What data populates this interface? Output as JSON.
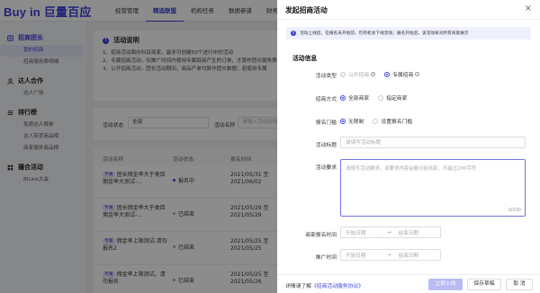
{
  "app": {
    "logo": "Buy in 巨量百应",
    "nav": [
      "经营管理",
      "精选联盟",
      "机构任务",
      "数据参谋",
      "财务结算"
    ],
    "nav_active": 1
  },
  "sidebar": {
    "groups": [
      {
        "label": "招商团长",
        "icon": "team-icon",
        "active": true,
        "items": [
          {
            "label": "我的招商",
            "active": true
          },
          {
            "label": "招商服务费明细",
            "active": false
          }
        ]
      },
      {
        "label": "达人合作",
        "icon": "cooperation-icon",
        "active": false,
        "items": [
          {
            "label": "达人广场",
            "active": false
          }
        ]
      },
      {
        "label": "排行榜",
        "icon": "ranking-icon",
        "active": false,
        "items": [
          {
            "label": "免费达人榜单",
            "active": false
          },
          {
            "label": "达人带货商品榜",
            "active": false
          },
          {
            "label": "商家服务商品榜",
            "active": false
          }
        ]
      },
      {
        "label": "撮合活动",
        "icon": "match-icon",
        "active": false,
        "items": [
          {
            "label": "BiLink大会",
            "active": false
          }
        ]
      }
    ]
  },
  "activity_desc": {
    "title": "活动说明",
    "lines": [
      "1、招商活动面向科目商家，最多可创建50个进行中的活动",
      "2、专属招商活动，仅推广时间内使用专属链接产生的订单，才算作团长服务费",
      "3、公开招商活动，团长活动期间，商品产单均算作团长数据；若使用专属"
    ]
  },
  "filters": {
    "status_label": "活动状态",
    "status_value": "全部",
    "name_label": "活动名称",
    "name_placeholder": "请输入活动名称"
  },
  "table": {
    "headers": [
      "活动名称",
      "活动状态",
      "报名时间"
    ],
    "rows": [
      {
        "tag": "专属",
        "name": "团长佣金率大于类目佣金率大测试-...",
        "status": "报名中",
        "status_done": false,
        "time": "2021/05/31 至 2021/06/02"
      },
      {
        "tag": "专属",
        "name": "团长佣金率大于类目佣金率大测试-...",
        "status": "已结束",
        "status_done": true,
        "time": "2021/05/29 至 2021/05/29"
      },
      {
        "tag": "专属",
        "name": "佣金率上限测试-请勿报名2",
        "status": "已结束",
        "status_done": true,
        "time": "2021/05/25 至 2021/05/25"
      },
      {
        "tag": "专属",
        "name": "佣金率上限测试，请勿报名",
        "status": "已结束",
        "status_done": true,
        "time": "2021/05/25 至 2021/05/26"
      }
    ]
  },
  "drawer": {
    "title": "发起招商活动",
    "close": "×",
    "notice": "活动上线后，在报名未开始前，仍有机会下线活动；报名开始后，该活动将对所有商家展示",
    "section": "活动信息",
    "activity_type": {
      "label": "活动类型",
      "options": [
        {
          "label": "公开招商",
          "checked": false,
          "disabled": true,
          "help": true
        },
        {
          "label": "专属招商",
          "checked": true,
          "disabled": false,
          "help": true
        }
      ]
    },
    "invite_method": {
      "label": "招商方式",
      "options": [
        {
          "label": "全部商家",
          "checked": true
        },
        {
          "label": "指定商家",
          "checked": false
        }
      ]
    },
    "threshold": {
      "label": "报名门槛",
      "options": [
        {
          "label": "无限制",
          "checked": true
        },
        {
          "label": "设置报名门槛",
          "checked": false
        }
      ]
    },
    "activity_title": {
      "label": "活动标题",
      "placeholder": "请填写活动标题"
    },
    "activity_requirement": {
      "label": "活动要求",
      "placeholder": "请填写活动要求，该要求内容会展示给商家，不能过200字符",
      "counter": "0/200"
    },
    "signup_time": {
      "label": "商家报名时间",
      "start": "开始日期",
      "end": "结束日期",
      "sep": "→"
    },
    "promo_time": {
      "label": "推广时间",
      "start": "开始日期",
      "end": "结束日期",
      "sep": "→"
    },
    "footer": {
      "text": "详情请了解",
      "link": "《招商活动服务协议》",
      "publish": "立即上线",
      "save_draft": "保存草稿",
      "cancel": "取 消"
    }
  }
}
